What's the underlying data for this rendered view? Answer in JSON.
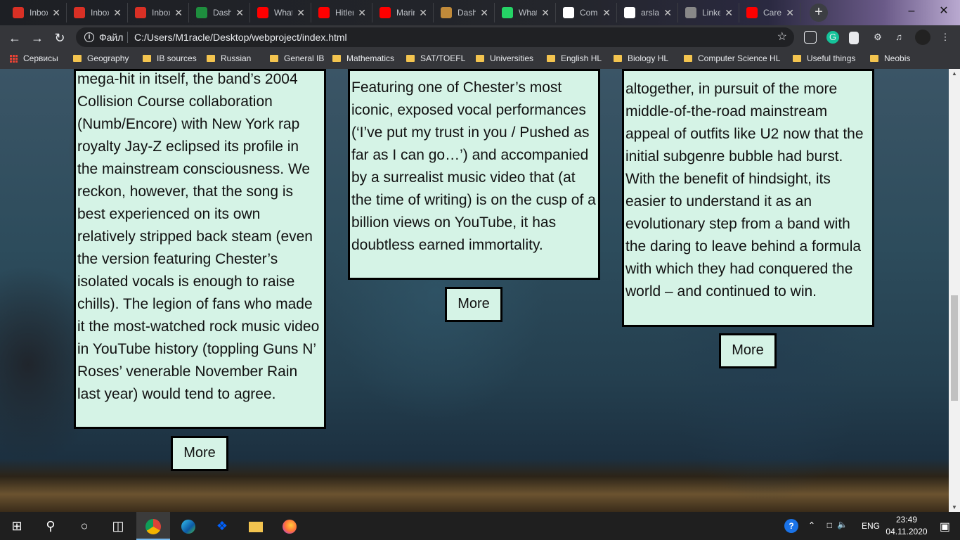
{
  "tabs": [
    {
      "label": "Inbox",
      "icon": "gmail-icon",
      "color": "#d93025"
    },
    {
      "label": "Inbox",
      "icon": "gmail-icon",
      "color": "#d93025"
    },
    {
      "label": "Inbox",
      "icon": "gmail-icon",
      "color": "#d93025"
    },
    {
      "label": "Dashboard",
      "icon": "dash-icon",
      "color": "#1e8e3e"
    },
    {
      "label": "WhatsApp",
      "icon": "youtube-icon",
      "color": "#ff0000"
    },
    {
      "label": "Hitler",
      "icon": "youtube-icon",
      "color": "#ff0000"
    },
    {
      "label": "Marina",
      "icon": "youtube-icon",
      "color": "#ff0000"
    },
    {
      "label": "Dashboard",
      "icon": "dash-icon",
      "color": "#c08a3a"
    },
    {
      "label": "WhatsApp",
      "icon": "whatsapp-icon",
      "color": "#25d366"
    },
    {
      "label": "Commits",
      "icon": "github-icon",
      "color": "#ffffff"
    },
    {
      "label": "arslan",
      "icon": "github-icon",
      "color": "#ffffff"
    },
    {
      "label": "LinkedIn",
      "icon": "globe-icon",
      "color": "#888888"
    },
    {
      "label": "Careers",
      "icon": "youtube-icon",
      "color": "#ff0000"
    }
  ],
  "address": {
    "scheme_label": "Файл",
    "url": "C:/Users/M1racle/Desktop/webproject/index.html"
  },
  "bookmarks": {
    "apps_label": "Сервисы",
    "items": [
      "Geography",
      "IB sources",
      "Russian",
      "General IB",
      "Mathematics",
      "SAT/TOEFL",
      "Universities",
      "English HL",
      "Biology HL",
      "Computer Science HL",
      "Useful things",
      "Neobis"
    ]
  },
  "cards": [
    {
      "text": "mega-hit in itself, the band’s 2004 Collision Course collaboration (Numb/Encore) with New York rap royalty Jay-Z eclipsed its profile in the mainstream consciousness. We reckon, however, that the song is best experienced on its own relatively stripped back steam (even the version featuring Chester’s isolated vocals is enough to raise chills). The legion of fans who made it the most-watched rock music video in YouTube history (toppling Guns N’ Roses’ venerable November Rain last year) would tend to agree.",
      "more": "More"
    },
    {
      "text": "Featuring one of Chester’s most iconic, exposed vocal performances (‘I’ve put my trust in you / Pushed as far as I can go…’) and accompanied by a surrealist music video that (at the time of writing) is on the cusp of a billion views on YouTube, it has doubtless earned immortality.",
      "more": "More"
    },
    {
      "text": "altogether, in pursuit of the more middle-of-the-road mainstream appeal of outfits like U2 now that the initial subgenre bubble had burst. With the benefit of hindsight, its easier to understand it as an evolutionary step from a band with the daring to leave behind a formula with which they had conquered the world – and continued to win.",
      "more": "More"
    }
  ],
  "tray": {
    "lang": "ENG",
    "time": "23:49",
    "date": "04.11.2020"
  },
  "colors": {
    "card_bg": "#d5f3e6",
    "accent": "#76b9ed"
  }
}
